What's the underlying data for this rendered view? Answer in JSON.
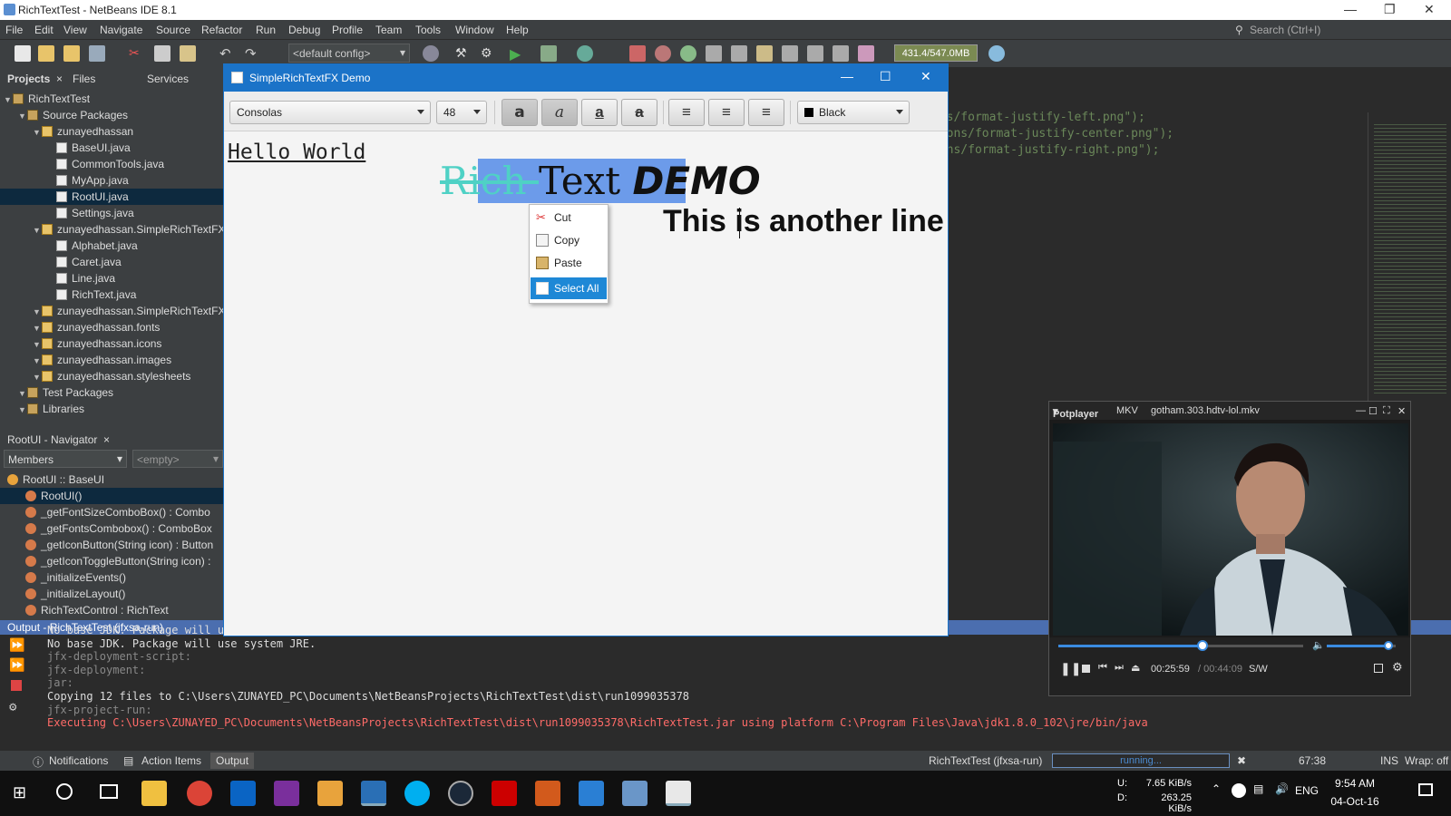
{
  "window": {
    "title": "RichTextTest - NetBeans IDE 8.1"
  },
  "menu": [
    "File",
    "Edit",
    "View",
    "Navigate",
    "Source",
    "Refactor",
    "Run",
    "Debug",
    "Profile",
    "Team",
    "Tools",
    "Window",
    "Help"
  ],
  "search": {
    "placeholder": "Search (Ctrl+I)"
  },
  "toolbar": {
    "config": "<default config>",
    "memory": "431.4/547.0MB"
  },
  "projects": {
    "tabs": [
      "Projects",
      "Files",
      "Services"
    ],
    "tree": [
      {
        "label": "RichTextTest",
        "level": 0,
        "type": "project"
      },
      {
        "label": "Source Packages",
        "level": 1,
        "type": "pkg"
      },
      {
        "label": "zunayedhassan",
        "level": 2,
        "type": "pk"
      },
      {
        "label": "BaseUI.java",
        "level": 3,
        "type": "jf"
      },
      {
        "label": "CommonTools.java",
        "level": 3,
        "type": "jf"
      },
      {
        "label": "MyApp.java",
        "level": 3,
        "type": "jf"
      },
      {
        "label": "RootUI.java",
        "level": 3,
        "type": "jf",
        "selected": true
      },
      {
        "label": "Settings.java",
        "level": 3,
        "type": "jf"
      },
      {
        "label": "zunayedhassan.SimpleRichTextFX",
        "level": 2,
        "type": "pk"
      },
      {
        "label": "Alphabet.java",
        "level": 3,
        "type": "jf"
      },
      {
        "label": "Caret.java",
        "level": 3,
        "type": "jf"
      },
      {
        "label": "Line.java",
        "level": 3,
        "type": "jf"
      },
      {
        "label": "RichText.java",
        "level": 3,
        "type": "jf"
      },
      {
        "label": "zunayedhassan.SimpleRichTextFX",
        "level": 2,
        "type": "pk"
      },
      {
        "label": "zunayedhassan.fonts",
        "level": 2,
        "type": "pk"
      },
      {
        "label": "zunayedhassan.icons",
        "level": 2,
        "type": "pk"
      },
      {
        "label": "zunayedhassan.images",
        "level": 2,
        "type": "pk"
      },
      {
        "label": "zunayedhassan.stylesheets",
        "level": 2,
        "type": "pk"
      },
      {
        "label": "Test Packages",
        "level": 1,
        "type": "pkg"
      },
      {
        "label": "Libraries",
        "level": 1,
        "type": "pkg"
      }
    ]
  },
  "navigator": {
    "title": "RootUI - Navigator",
    "members": "Members",
    "filter": "<empty>",
    "items": [
      {
        "label": "RootUI :: BaseUI",
        "level": 0
      },
      {
        "label": "RootUI()",
        "level": 1,
        "selected": true
      },
      {
        "label": "_getFontSizeComboBox() : Combo",
        "level": 1
      },
      {
        "label": "_getFontsCombobox() : ComboBox",
        "level": 1
      },
      {
        "label": "_getIconButton(String icon) : Button",
        "level": 1
      },
      {
        "label": "_getIconToggleButton(String icon) :",
        "level": 1
      },
      {
        "label": "_initializeEvents()",
        "level": 1
      },
      {
        "label": "_initializeLayout()",
        "level": 1
      },
      {
        "label": "RichTextControl : RichText",
        "level": 1
      }
    ]
  },
  "code_lines": [
    "ons/format-justify-left.png\");",
    "icons/format-justify-center.png\");",
    "cons/format-justify-right.png\");"
  ],
  "dialog": {
    "title": "SimpleRichTextFX Demo",
    "font": "Consolas",
    "size": "48",
    "color": "Black",
    "hello": "Hello World",
    "rich1": "Rich ",
    "rich2": "Text ",
    "demo": "DEMO",
    "another": "This is another line"
  },
  "context_menu": [
    {
      "label": "Cut",
      "icon": "scissors-icon"
    },
    {
      "label": "Copy",
      "icon": "copy-icon"
    },
    {
      "label": "Paste",
      "icon": "paste-icon"
    },
    {
      "label": "Select All",
      "icon": "select-all-icon",
      "selected": true
    }
  ],
  "output": {
    "title": "Output - RichTextTest (jfxsa-run)",
    "lines": [
      {
        "t": "No base JDK. Package will use system JRE.",
        "c": "owhite"
      },
      {
        "t": "No base JDK. Package will use system JRE.",
        "c": "owhite"
      },
      {
        "t": "jfx-deployment-script:",
        "c": "ogray"
      },
      {
        "t": "jfx-deployment:",
        "c": "ogray"
      },
      {
        "t": "jar:",
        "c": "ogray"
      },
      {
        "t": "Copying 12 files to C:\\Users\\ZUNAYED_PC\\Documents\\NetBeansProjects\\RichTextTest\\dist\\run1099035378",
        "c": "owhite"
      },
      {
        "t": "jfx-project-run:",
        "c": "ogray"
      },
      {
        "t": "Executing C:\\Users\\ZUNAYED_PC\\Documents\\NetBeansProjects\\RichTextTest\\dist\\run1099035378\\RichTextTest.jar using platform C:\\Program Files\\Java\\jdk1.8.0_102\\jre/bin/java",
        "c": "ored"
      }
    ]
  },
  "statusbar": {
    "notifications": "Notifications",
    "action_items": "Action Items",
    "output": "Output",
    "run_label": "RichTextTest (jfxsa-run)",
    "progress": "running...",
    "position": "67:38",
    "mode": "INS",
    "wrap": "Wrap: off"
  },
  "player": {
    "name": "Potplayer",
    "format": "MKV",
    "file": "gotham.303.hdtv-lol.mkv",
    "time": "00:25:59",
    "total": "/ 00:44:09",
    "sw": "S/W",
    "progress": 0.59,
    "volume": 0.9
  },
  "taskbar": {
    "net_up_label": "U:",
    "net_up": "7.65 KiB/s",
    "net_down_label": "D:",
    "net_down": "263.25 KiB/s",
    "lang": "ENG",
    "time": "9:54 AM",
    "date": "04-Oct-16"
  }
}
